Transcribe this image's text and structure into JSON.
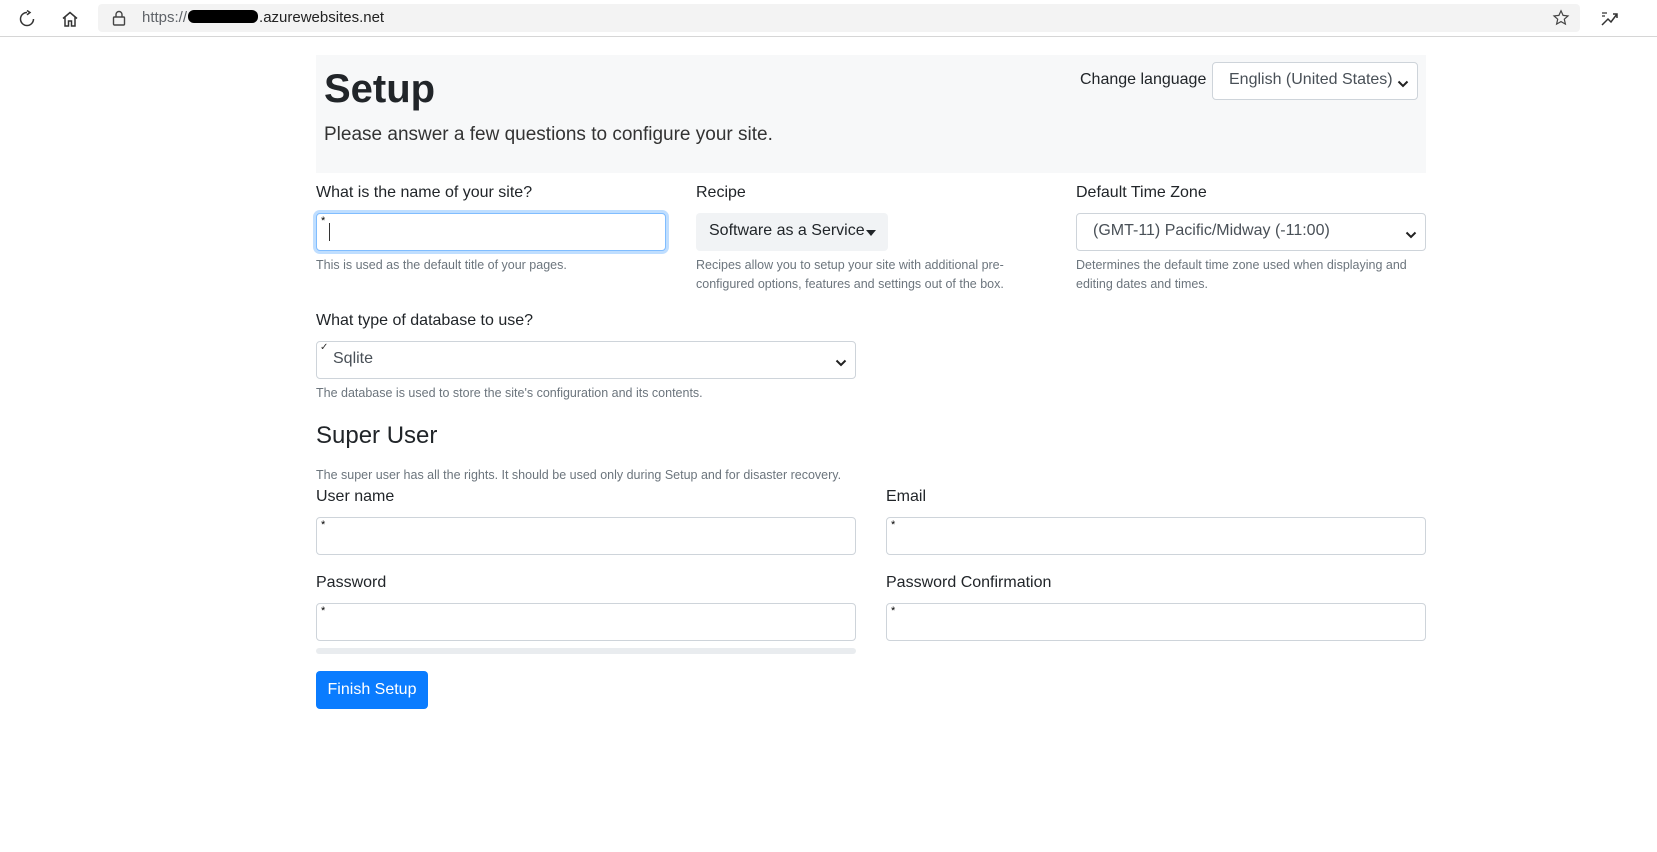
{
  "browser": {
    "url_protocol": "https://",
    "url_domain": ".azurewebsites.net",
    "icons": [
      "refresh-icon",
      "home-icon",
      "lock-icon",
      "star-icon",
      "extensions-icon"
    ]
  },
  "header": {
    "title": "Setup",
    "lead": "Please answer a few questions to configure your site.",
    "language_label": "Change language",
    "language_value": "English (United States)"
  },
  "site": {
    "label": "What is the name of your site?",
    "value": "",
    "required_marker": "*",
    "help": "This is used as the default title of your pages."
  },
  "recipe": {
    "label": "Recipe",
    "button_label": "Software as a Service",
    "help": "Recipes allow you to setup your site with additional pre-configured options, features and settings out of the box."
  },
  "timezone": {
    "label": "Default Time Zone",
    "value": "(GMT-11) Pacific/Midway (-11:00)",
    "help": "Determines the default time zone used when displaying and editing dates and times."
  },
  "database": {
    "label": "What type of database to use?",
    "value": "Sqlite",
    "valid_marker": "✓",
    "help": "The database is used to store the site's configuration and its contents."
  },
  "super_user": {
    "title": "Super User",
    "help": "The super user has all the rights. It should be used only during Setup and for disaster recovery.",
    "username_label": "User name",
    "email_label": "Email",
    "password_label": "Password",
    "password_confirmation_label": "Password Confirmation",
    "required_marker": "*"
  },
  "password_strength": 0,
  "actions": {
    "finish_label": "Finish Setup"
  },
  "colors": {
    "primary": "#0a7cff",
    "jumbotron": "#f7f8f9",
    "focus_border": "#80bdff"
  }
}
